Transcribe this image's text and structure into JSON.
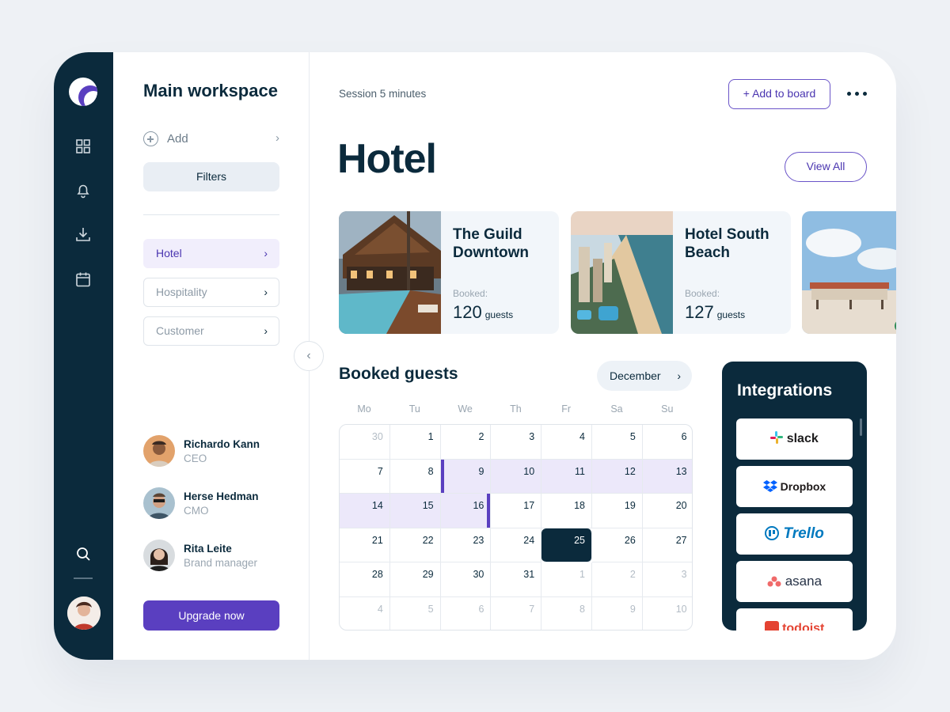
{
  "workspace": {
    "title": "Main workspace",
    "add_label": "Add",
    "filters_label": "Filters",
    "nav": [
      {
        "label": "Hotel",
        "active": true
      },
      {
        "label": "Hospitality",
        "active": false
      },
      {
        "label": "Customer",
        "active": false
      }
    ],
    "people": [
      {
        "name": "Richardo Kann",
        "role": "CEO"
      },
      {
        "name": "Herse Hedman",
        "role": "CMO"
      },
      {
        "name": "Rita Leite",
        "role": "Brand manager"
      }
    ],
    "upgrade_label": "Upgrade now"
  },
  "header": {
    "session": "Session 5 minutes",
    "add_board_label": "Add to board"
  },
  "hotel": {
    "title": "Hotel",
    "view_all_label": "View All",
    "cards": [
      {
        "name": "The Guild Downtown",
        "booked_label": "Booked:",
        "count": "120",
        "unit": "guests"
      },
      {
        "name": "Hotel South Beach",
        "booked_label": "Booked:",
        "count": "127",
        "unit": "guests"
      }
    ]
  },
  "calendar": {
    "title": "Booked guests",
    "month": "December",
    "weekdays": [
      "Mo",
      "Tu",
      "We",
      "Th",
      "Fr",
      "Sa",
      "Su"
    ],
    "rows": [
      [
        "30",
        "1",
        "2",
        "3",
        "4",
        "5",
        "6"
      ],
      [
        "7",
        "8",
        "9",
        "10",
        "11",
        "12",
        "13"
      ],
      [
        "14",
        "15",
        "16",
        "17",
        "18",
        "19",
        "20"
      ],
      [
        "21",
        "22",
        "23",
        "24",
        "25",
        "26",
        "27"
      ],
      [
        "28",
        "29",
        "30",
        "31",
        "1",
        "2",
        "3"
      ],
      [
        "4",
        "5",
        "6",
        "7",
        "8",
        "9",
        "10"
      ]
    ],
    "selected_day": "25",
    "booked_range": "9 – 16"
  },
  "integrations": {
    "title": "Integrations",
    "items": [
      "slack",
      "Dropbox",
      "Trello",
      "asana",
      "todoist"
    ]
  },
  "colors": {
    "sidebar": "#0b2a3c",
    "accent": "#5a3fc0",
    "range_fill": "#ece8fa"
  }
}
